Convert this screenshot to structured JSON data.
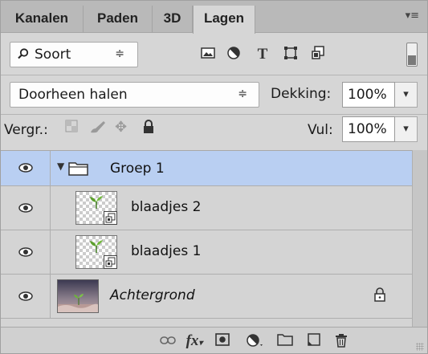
{
  "tabs": [
    {
      "label": "Kanalen"
    },
    {
      "label": "Paden"
    },
    {
      "label": "3D"
    },
    {
      "label": "Lagen"
    }
  ],
  "filter": {
    "selected": "Soort",
    "icons": [
      "image-filter-icon",
      "adjustment-filter-icon",
      "type-filter-icon",
      "shape-filter-icon",
      "smart-object-filter-icon"
    ]
  },
  "blend": {
    "mode": "Doorheen halen",
    "opacity_label": "Dekking:",
    "opacity_value": "100%"
  },
  "lock": {
    "label": "Vergr.:",
    "fill_label": "Vul:",
    "fill_value": "100%"
  },
  "layers": [
    {
      "name": "Groep 1",
      "type": "group",
      "selected": true
    },
    {
      "name": "blaadjes 2",
      "type": "smart-object"
    },
    {
      "name": "blaadjes 1",
      "type": "smart-object"
    },
    {
      "name": "Achtergrond",
      "type": "background",
      "locked": true
    }
  ],
  "colors": {
    "selection": "#b9cff2",
    "panel": "#d6d6d6"
  }
}
